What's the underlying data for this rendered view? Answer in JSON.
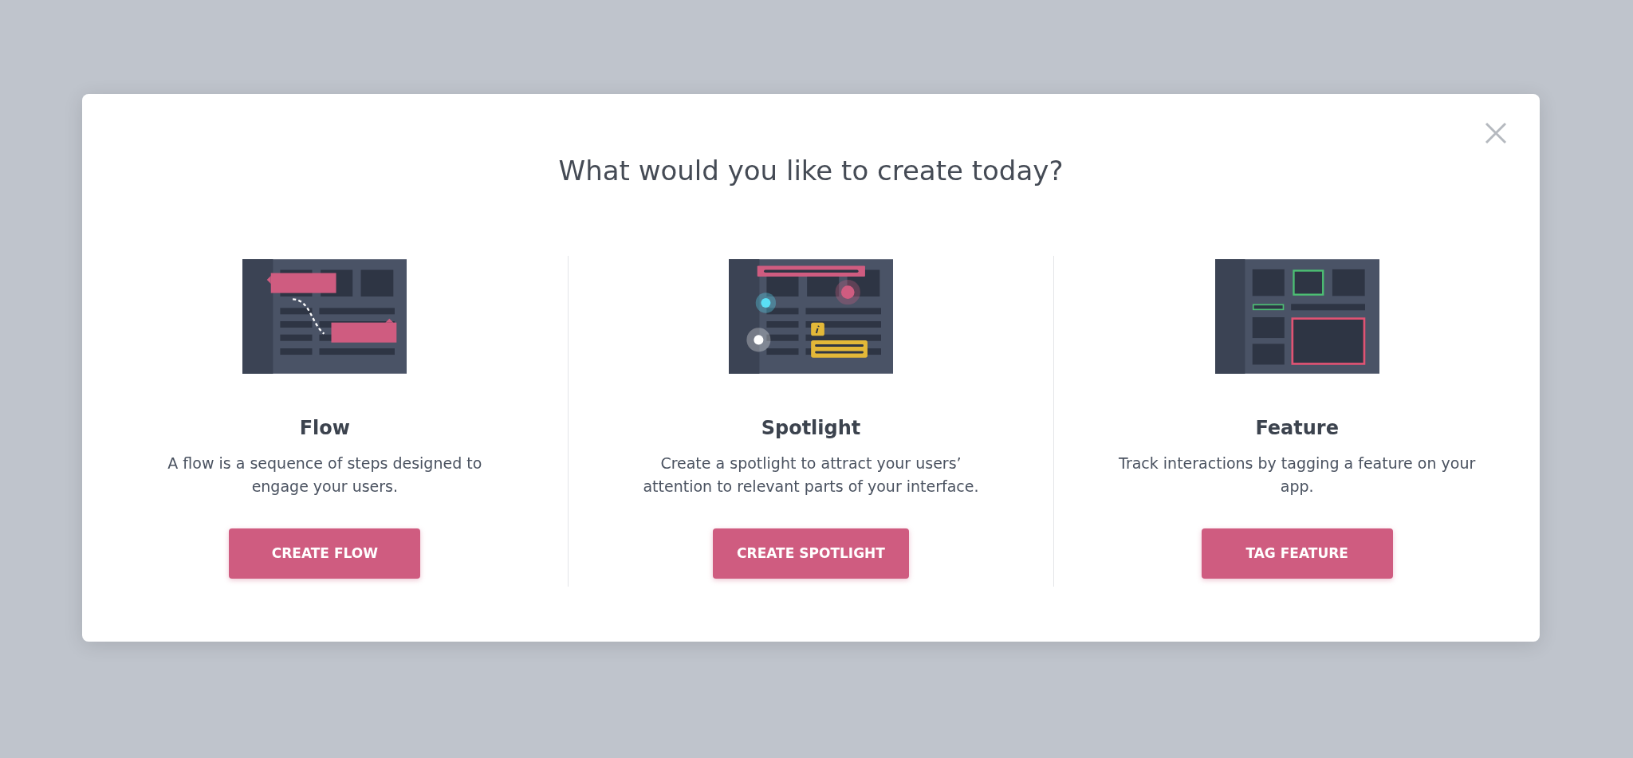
{
  "modal": {
    "title": "What would you like to create today?",
    "options": [
      {
        "kind": "flow",
        "heading": "Flow",
        "description": "A flow is a sequence of steps designed to engage your users.",
        "button": "CREATE FLOW"
      },
      {
        "kind": "spotlight",
        "heading": "Spotlight",
        "description": "Create a spotlight to attract your users’ attention to relevant parts of your interface.",
        "button": "CREATE SPOTLIGHT"
      },
      {
        "kind": "feature",
        "heading": "Feature",
        "description": "Track interactions by tagging a feature on your app.",
        "button": "TAG FEATURE"
      }
    ]
  }
}
